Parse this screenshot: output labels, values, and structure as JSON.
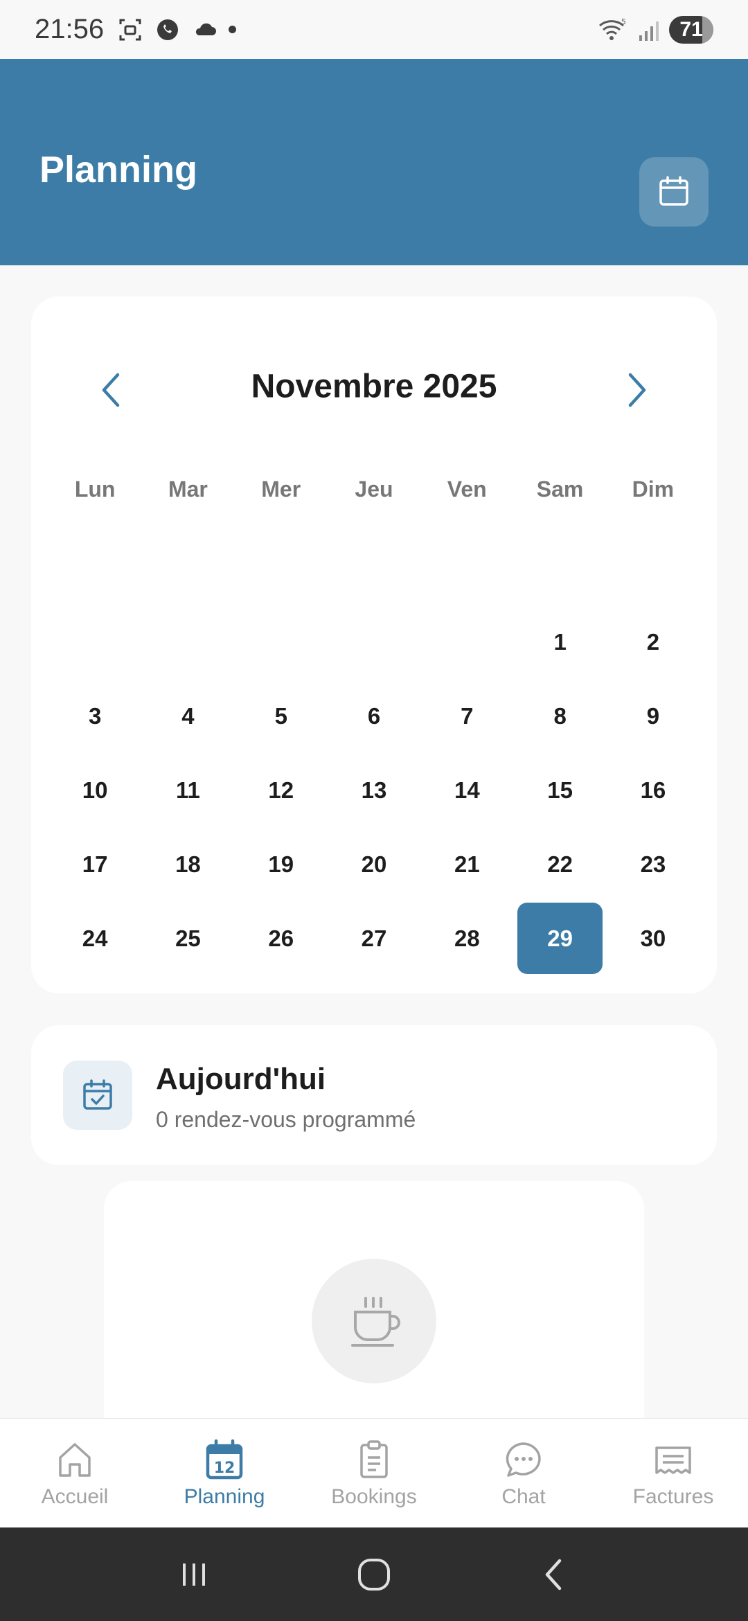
{
  "status_bar": {
    "time": "21:56",
    "battery": "71"
  },
  "header": {
    "title": "Planning"
  },
  "calendar": {
    "month_label": "Novembre 2025",
    "weekdays": [
      "Lun",
      "Mar",
      "Mer",
      "Jeu",
      "Ven",
      "Sam",
      "Dim"
    ],
    "days": [
      "1",
      "2",
      "3",
      "4",
      "5",
      "6",
      "7",
      "8",
      "9",
      "10",
      "11",
      "12",
      "13",
      "14",
      "15",
      "16",
      "17",
      "18",
      "19",
      "20",
      "21",
      "22",
      "23",
      "24",
      "25",
      "26",
      "27",
      "28",
      "29",
      "30"
    ],
    "selected_day": "29"
  },
  "today": {
    "title": "Aujourd'hui",
    "subtitle": "0 rendez-vous programmé"
  },
  "bottom_nav": {
    "items": [
      {
        "label": "Accueil",
        "icon": "home-icon"
      },
      {
        "label": "Planning",
        "icon": "calendar-12-icon",
        "active": true
      },
      {
        "label": "Bookings",
        "icon": "clipboard-icon"
      },
      {
        "label": "Chat",
        "icon": "chat-bubble-icon"
      },
      {
        "label": "Factures",
        "icon": "receipt-icon"
      }
    ]
  },
  "colors": {
    "primary": "#3c7ca6",
    "background": "#f8f8f8",
    "card": "#ffffff"
  }
}
